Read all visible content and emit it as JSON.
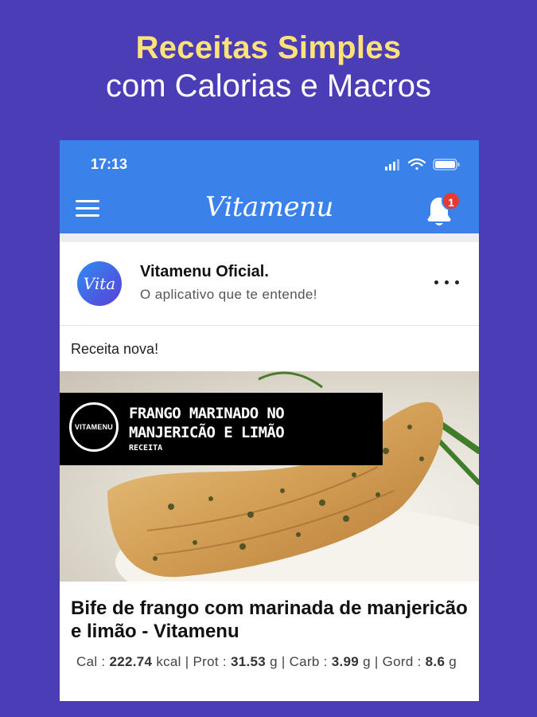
{
  "promo": {
    "headline": "Receitas Simples",
    "subheadline": "com Calorias e Macros"
  },
  "status_bar": {
    "time": "17:13"
  },
  "app_bar": {
    "brand": "Vitamenu",
    "notification_count": "1"
  },
  "post": {
    "avatar_text": "Vita",
    "author": "Vitamenu Oficial.",
    "tagline": "O aplicativo que te entende!",
    "text": "Receita nova!",
    "image": {
      "logo_text": "VITAMENU",
      "banner_title": "FRANGO MARINADO NO MANJERICÃO E LIMÃO",
      "banner_subtitle": "RECEITA"
    },
    "recipe_title": "Bife de frango com marinada de manjericão e limão - Vitamenu",
    "macros": {
      "cal_label": "Cal :",
      "cal_value": "222.74",
      "cal_unit": "kcal",
      "prot_label": "Prot :",
      "prot_value": "31.53",
      "prot_unit": "g",
      "carb_label": "Carb :",
      "carb_value": "3.99",
      "carb_unit": "g",
      "gord_label": "Gord :",
      "gord_value": "8.6",
      "gord_unit": "g"
    }
  },
  "colors": {
    "background": "#4a3db5",
    "headline": "#fde27a",
    "app_bar": "#3a82ea",
    "badge": "#e53935"
  },
  "icons": [
    "menu-icon",
    "bell-icon",
    "more-icon",
    "signal-icon",
    "wifi-icon",
    "battery-icon"
  ]
}
